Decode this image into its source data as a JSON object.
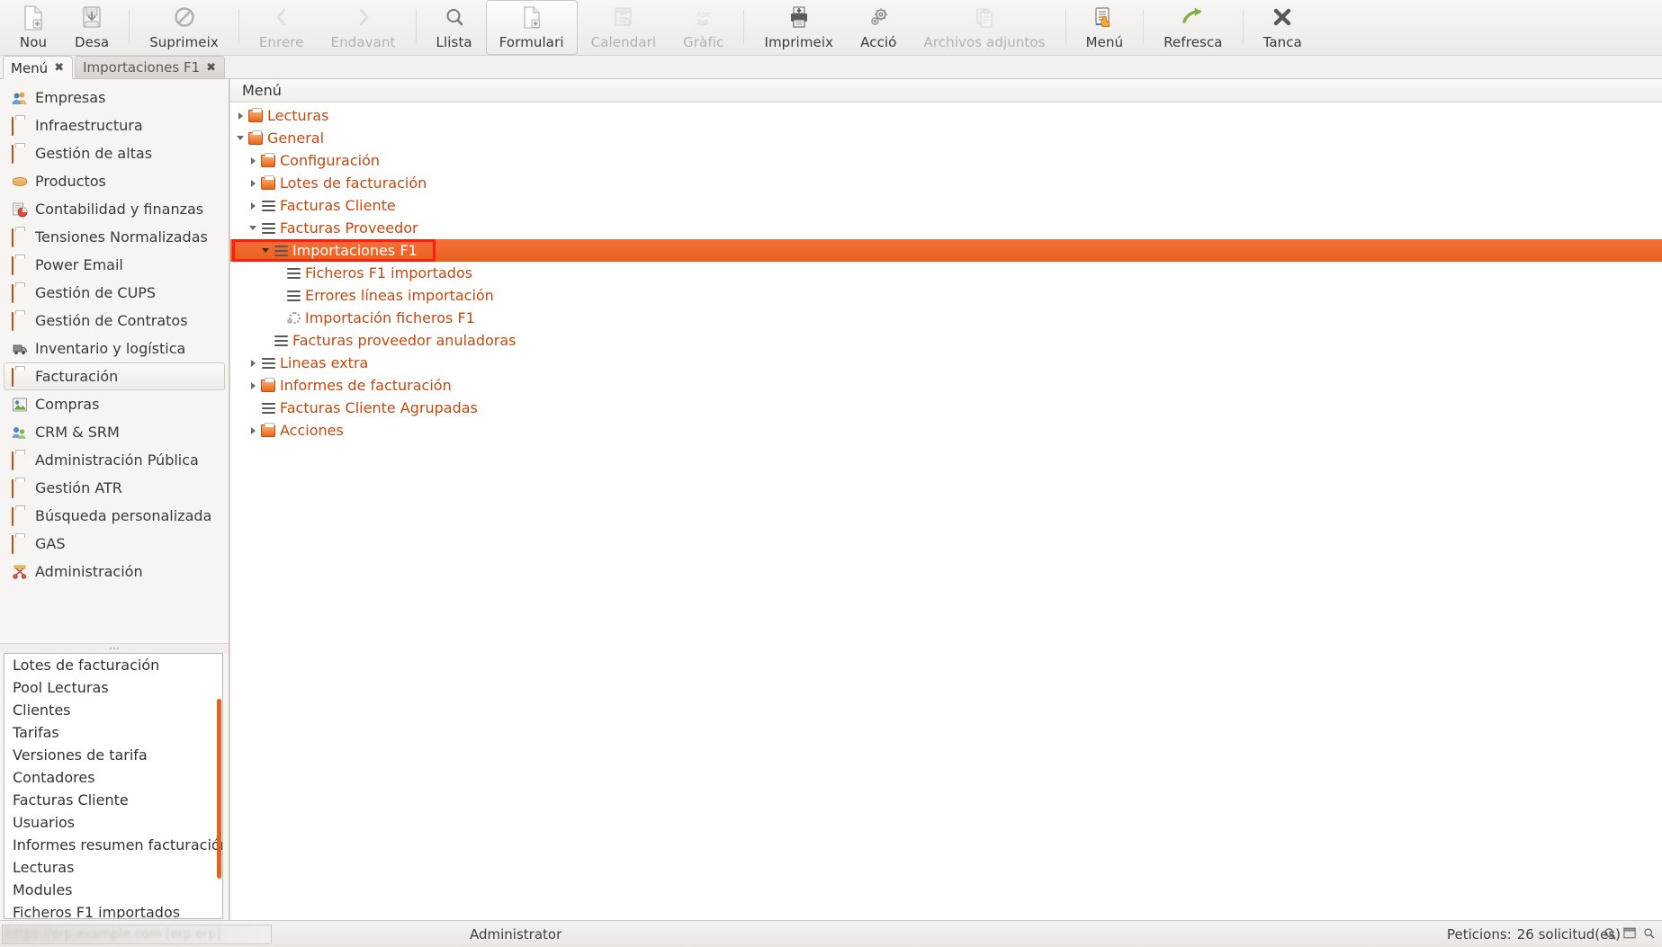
{
  "toolbar": {
    "buttons": [
      {
        "label": "Nou",
        "icon": "new-document-icon",
        "state": "enabled"
      },
      {
        "label": "Desa",
        "icon": "save-icon",
        "state": "enabled"
      },
      {
        "sep": true
      },
      {
        "label": "Suprimeix",
        "icon": "delete-forbidden-icon",
        "state": "enabled"
      },
      {
        "sep": true
      },
      {
        "label": "Enrere",
        "icon": "back-chevron-icon",
        "state": "disabled"
      },
      {
        "label": "Endavant",
        "icon": "forward-chevron-icon",
        "state": "disabled"
      },
      {
        "sep": true
      },
      {
        "label": "Llista",
        "icon": "search-list-icon",
        "state": "enabled"
      },
      {
        "label": "Formulari",
        "icon": "form-document-icon",
        "state": "active"
      },
      {
        "label": "Calendari",
        "icon": "calendar-icon",
        "state": "disabled"
      },
      {
        "label": "Gràfic",
        "icon": "chart-abc-icon",
        "state": "disabled"
      },
      {
        "sep": true
      },
      {
        "label": "Imprimeix",
        "icon": "printer-icon",
        "state": "enabled"
      },
      {
        "label": "Acció",
        "icon": "gears-action-icon",
        "state": "enabled"
      },
      {
        "label": "Archivos adjuntos",
        "icon": "attachment-clipboard-icon",
        "state": "disabled"
      },
      {
        "sep": true
      },
      {
        "label": "Menú",
        "icon": "menu-hand-icon",
        "state": "enabled"
      },
      {
        "sep": true
      },
      {
        "label": "Refresca",
        "icon": "refresh-arrow-icon",
        "state": "enabled"
      },
      {
        "sep": true
      },
      {
        "label": "Tanca",
        "icon": "close-x-icon",
        "state": "enabled"
      }
    ]
  },
  "tabs": [
    {
      "label": "Menú",
      "selected": true,
      "close": "✖"
    },
    {
      "label": "Importaciones F1",
      "selected": false,
      "close": "✖"
    }
  ],
  "sidebar": {
    "shortcuts": [
      {
        "label": "Empresas",
        "icon": "companies-icon",
        "selected": false
      },
      {
        "label": "Infraestructura",
        "icon": "folder-icon",
        "selected": false
      },
      {
        "label": "Gestión de altas",
        "icon": "folder-icon",
        "selected": false
      },
      {
        "label": "Productos",
        "icon": "products-box-icon",
        "selected": false
      },
      {
        "label": "Contabilidad y finanzas",
        "icon": "accounting-chart-icon",
        "selected": false
      },
      {
        "label": "Tensiones Normalizadas",
        "icon": "folder-icon",
        "selected": false
      },
      {
        "label": "Power Email",
        "icon": "folder-icon",
        "selected": false
      },
      {
        "label": "Gestión de CUPS",
        "icon": "folder-icon",
        "selected": false
      },
      {
        "label": "Gestión de Contratos",
        "icon": "folder-icon",
        "selected": false
      },
      {
        "label": "Inventario y logística",
        "icon": "inventory-truck-icon",
        "selected": false
      },
      {
        "label": "Facturación",
        "icon": "folder-icon",
        "selected": true
      },
      {
        "label": "Compras",
        "icon": "purchases-icon",
        "selected": false
      },
      {
        "label": "CRM & SRM",
        "icon": "crm-icon",
        "selected": false
      },
      {
        "label": "Administración Pública",
        "icon": "folder-icon",
        "selected": false
      },
      {
        "label": "Gestión ATR",
        "icon": "folder-icon",
        "selected": false
      },
      {
        "label": "Búsqueda personalizada",
        "icon": "folder-icon",
        "selected": false
      },
      {
        "label": "GAS",
        "icon": "folder-icon",
        "selected": false
      },
      {
        "label": "Administración",
        "icon": "administration-icon",
        "selected": false
      }
    ],
    "history": [
      "Lotes de facturación",
      "Pool Lecturas",
      "Clientes",
      "Tarifas",
      "Versiones de tarifa",
      "Contadores",
      "Facturas Cliente",
      "Usuarios",
      "Informes resumen facturación",
      "Lecturas",
      "Modules",
      "Ficheros F1 importados"
    ]
  },
  "main": {
    "header": "Menú",
    "tree": [
      {
        "label": "Lecturas",
        "depth": 0,
        "twisty": "closed",
        "icon": "folder-icon"
      },
      {
        "label": "General",
        "depth": 0,
        "twisty": "open",
        "icon": "folder-icon"
      },
      {
        "label": "Configuración",
        "depth": 1,
        "twisty": "closed",
        "icon": "folder-icon"
      },
      {
        "label": "Lotes de facturación",
        "depth": 1,
        "twisty": "closed",
        "icon": "folder-icon"
      },
      {
        "label": "Facturas Cliente",
        "depth": 1,
        "twisty": "closed",
        "icon": "list-icon"
      },
      {
        "label": "Facturas Proveedor",
        "depth": 1,
        "twisty": "open",
        "icon": "list-icon"
      },
      {
        "label": "Importaciones F1",
        "depth": 2,
        "twisty": "open",
        "icon": "list-icon",
        "selected": true,
        "annotated": true
      },
      {
        "label": "Ficheros F1 importados",
        "depth": 3,
        "twisty": "none",
        "icon": "list-icon"
      },
      {
        "label": "Errores líneas importación",
        "depth": 3,
        "twisty": "none",
        "icon": "list-icon"
      },
      {
        "label": "Importación ficheros F1",
        "depth": 3,
        "twisty": "none",
        "icon": "gear-icon"
      },
      {
        "label": "Facturas proveedor anuladoras",
        "depth": 2,
        "twisty": "none",
        "icon": "list-icon"
      },
      {
        "label": "Lineas extra",
        "depth": 1,
        "twisty": "closed",
        "icon": "list-icon"
      },
      {
        "label": "Informes de facturación",
        "depth": 1,
        "twisty": "closed",
        "icon": "folder-icon"
      },
      {
        "label": "Facturas Cliente Agrupadas",
        "depth": 1,
        "twisty": "none",
        "icon": "list-icon"
      },
      {
        "label": "Acciones",
        "depth": 1,
        "twisty": "closed",
        "icon": "folder-icon"
      }
    ]
  },
  "statusbar": {
    "url_blurred": "https://erp.example.com [erp.erp]",
    "user": "Administrator",
    "requests_label": "Peticions:",
    "requests_value": "26 solicitud(es)",
    "icons": [
      "zoom-icon",
      "window-icon",
      "zoom-small-icon"
    ]
  },
  "colors": {
    "accent": "#e8601c",
    "annotation": "#fb1f10",
    "tree_text": "#c3490f"
  }
}
